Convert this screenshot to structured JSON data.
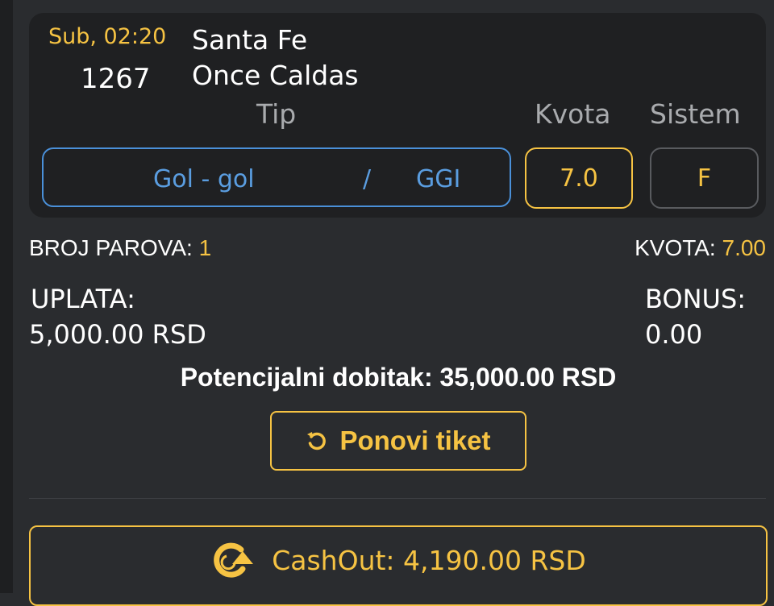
{
  "match": {
    "time": "Sub, 02:20",
    "code": "1267",
    "home_team": "Santa Fe",
    "away_team": "Once Caldas",
    "headers": {
      "tip": "Tip",
      "kvota": "Kvota",
      "sistem": "Sistem"
    },
    "tip_market": "Gol - gol",
    "tip_separator": "/",
    "tip_code": "GGI",
    "odd": "7.0",
    "system": "F"
  },
  "summary": {
    "pairs_label": "BROJ PAROVA:",
    "pairs_value": "1",
    "total_odd_label": "KVOTA:",
    "total_odd_value": "7.00",
    "stake_label": "UPLATA:",
    "stake_value": "5,000.00 RSD",
    "bonus_label": "BONUS:",
    "bonus_value": "0.00",
    "potential_win": "Potencijalni dobitak: 35,000.00 RSD"
  },
  "actions": {
    "repeat_label": "Ponovi tiket",
    "repeat_icon": "refresh-icon",
    "cashout_label": "CashOut: 4,190.00 RSD",
    "cashout_icon": "cashout-icon"
  },
  "colors": {
    "accent": "#f6c343",
    "tip_blue": "#5a9de0",
    "background": "#2a2c2f",
    "card": "#1f2022"
  }
}
